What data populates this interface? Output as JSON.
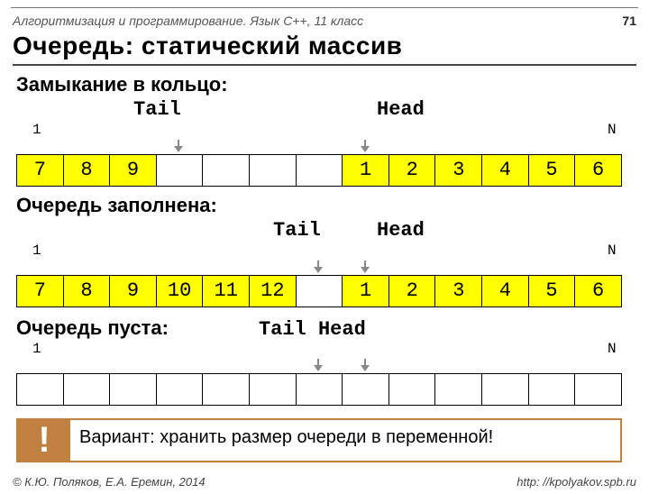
{
  "header": {
    "crumb": "Алгоритмизация и программирование. Язык C++, 11 класс",
    "page": "71"
  },
  "title": "Очередь: статический массив",
  "sec1": {
    "title": "Замыкание в кольцо:",
    "tail": "Tail",
    "head": "Head",
    "one": "1",
    "n": "N",
    "cells": [
      "7",
      "8",
      "9",
      "",
      "",
      "",
      "",
      "1",
      "2",
      "3",
      "4",
      "5",
      "6"
    ]
  },
  "sec2": {
    "title": "Очередь заполнена:",
    "tail": "Tail",
    "head": "Head",
    "one": "1",
    "n": "N",
    "cells": [
      "7",
      "8",
      "9",
      "10",
      "11",
      "12",
      "",
      "1",
      "2",
      "3",
      "4",
      "5",
      "6"
    ]
  },
  "sec3": {
    "title": "Очередь пуста:",
    "tailhead": "Tail Head",
    "one": "1",
    "n": "N",
    "cells": [
      "",
      "",
      "",
      "",
      "",
      "",
      "",
      "",
      "",
      "",
      "",
      "",
      ""
    ]
  },
  "note": {
    "mark": "!",
    "text": "Вариант: хранить размер очереди в переменной!"
  },
  "footer": {
    "left": "© К.Ю. Поляков, Е.А. Еремин, 2014",
    "right": "http: //kpolyakov.spb.ru"
  }
}
